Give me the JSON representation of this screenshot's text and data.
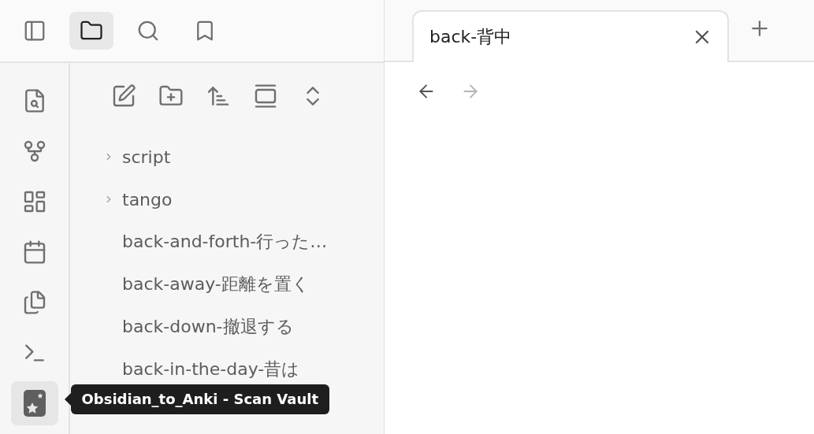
{
  "top_tabs": [
    {
      "selected": false
    },
    {
      "selected": true
    },
    {
      "selected": false
    },
    {
      "selected": false
    }
  ],
  "ribbon": [
    {
      "selected": false
    },
    {
      "selected": false
    },
    {
      "selected": false
    },
    {
      "selected": false
    },
    {
      "selected": false
    },
    {
      "selected": false
    },
    {
      "selected": true,
      "tooltip": "Obsidian_to_Anki - Scan Vault"
    }
  ],
  "file_tree": [
    {
      "kind": "folder",
      "name": "script",
      "expanded": false
    },
    {
      "kind": "folder",
      "name": "tango",
      "expanded": false
    },
    {
      "kind": "file",
      "name": "back-and-forth-行った…"
    },
    {
      "kind": "file",
      "name": "back-away-距離を置く"
    },
    {
      "kind": "file",
      "name": "back-down-撤退する"
    },
    {
      "kind": "file",
      "name": "back-in-the-day-昔は"
    }
  ],
  "editor_tabs": [
    {
      "label": "back-背中",
      "selected": true
    }
  ],
  "nav": {
    "back_disabled": false,
    "forward_disabled": true
  }
}
